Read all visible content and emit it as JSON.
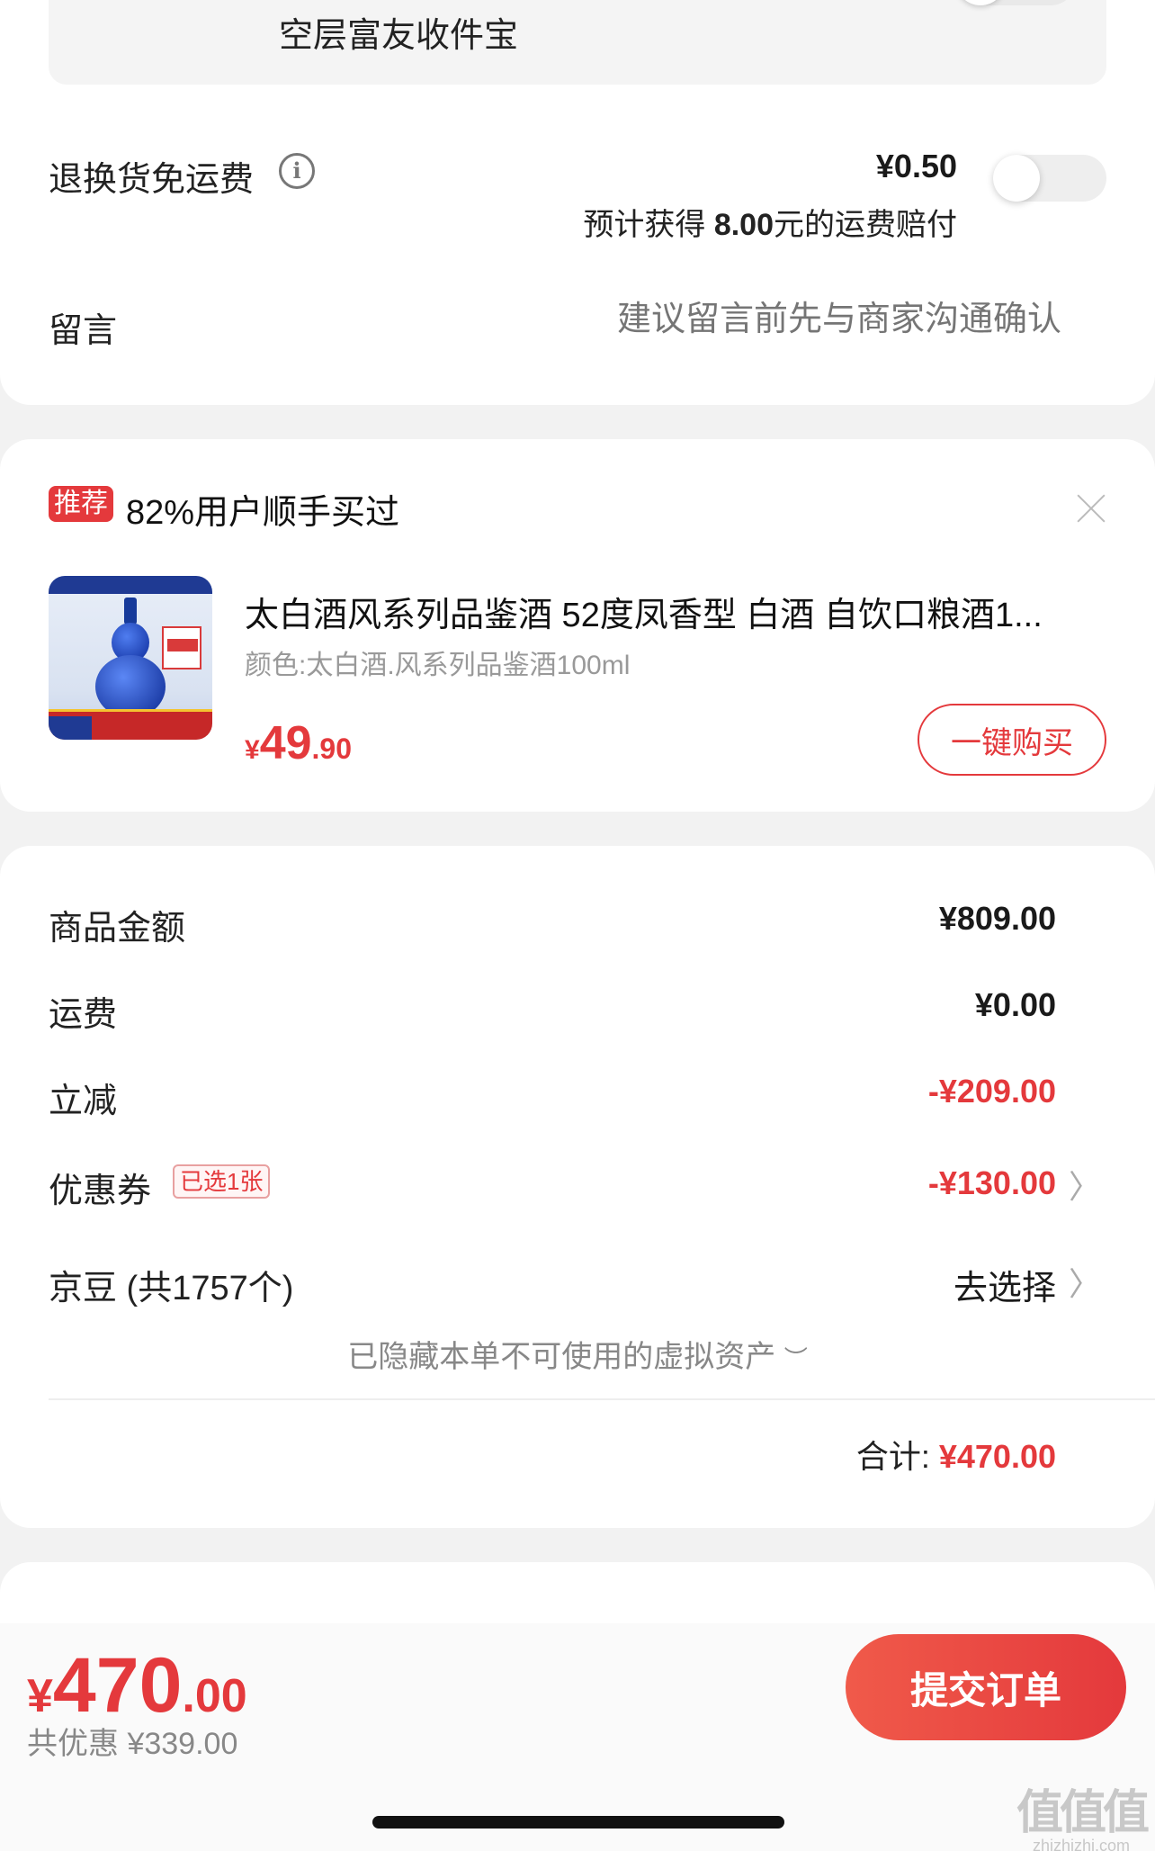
{
  "address": {
    "text": "空层富友收件宝"
  },
  "freight": {
    "label": "退换货免运费",
    "price": "¥0.50",
    "desc_prefix": "预计获得",
    "desc_amount": "8.00",
    "desc_suffix": "元的运费赔付"
  },
  "note": {
    "label": "留言",
    "placeholder": "建议留言前先与商家沟通确认"
  },
  "recommend": {
    "tag": "推荐",
    "title": "82%用户顺手买过",
    "product": {
      "name": "太白酒风系列品鉴酒 52度凤香型 白酒 自饮口粮酒1...",
      "spec": "颜色:太白酒.风系列品鉴酒100ml",
      "price_currency": "¥",
      "price_int": "49",
      "price_dec": ".90",
      "buy_label": "一键购买"
    }
  },
  "summary": {
    "goods_label": "商品金额",
    "goods_value": "¥809.00",
    "shipping_label": "运费",
    "shipping_value": "¥0.00",
    "instant_discount_label": "立减",
    "instant_discount_value": "-¥209.00",
    "coupon_label": "优惠券",
    "coupon_tag": "已选1张",
    "coupon_value": "-¥130.00",
    "beans_label": "京豆 (共1757个)",
    "beans_action": "去选择",
    "hidden_assets": "已隐藏本单不可使用的虚拟资产",
    "total_label": "合计:",
    "total_value": "¥470.00"
  },
  "bottom_bar": {
    "currency": "¥",
    "amount_int": "470",
    "amount_dec": ".00",
    "discount_text": "共优惠 ¥339.00",
    "submit_label": "提交订单"
  },
  "watermark": {
    "main": "值值值",
    "sub": "zhizhizhi.com"
  },
  "colors": {
    "accent": "#e4393c",
    "background": "#f2f2f2",
    "card": "#ffffff"
  }
}
